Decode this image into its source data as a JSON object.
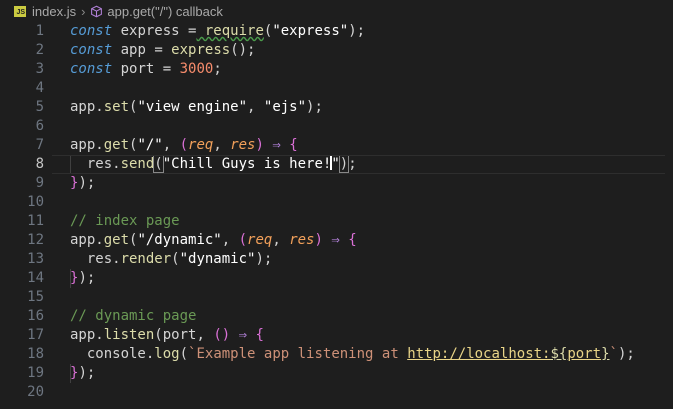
{
  "breadcrumb": {
    "file_icon_text": "JS",
    "file": "index.js",
    "symbol": "app.get(\"/\") callback"
  },
  "line_numbers": [
    "1",
    "2",
    "3",
    "4",
    "5",
    "6",
    "7",
    "8",
    "9",
    "10",
    "11",
    "12",
    "13",
    "14",
    "15",
    "16",
    "17",
    "18",
    "19",
    "20"
  ],
  "code": {
    "l1": {
      "kw": "const",
      "a": " express ",
      "op": "=",
      "fn": " require",
      "b": "(",
      "str": "\"express\"",
      "c": ");"
    },
    "l2": {
      "kw": "const",
      "a": " app ",
      "op": "=",
      "fn": " express",
      "b": "();"
    },
    "l3": {
      "kw": "const",
      "a": " port ",
      "op": "=",
      "num": " 3000",
      "b": ";"
    },
    "l5": {
      "a": "app.",
      "fn": "set",
      "b": "(",
      "s1": "\"view engine\"",
      "c": ", ",
      "s2": "\"ejs\"",
      "d": ");"
    },
    "l7": {
      "a": "app.",
      "fn": "get",
      "b": "(",
      "s1": "\"/\"",
      "c": ", ",
      "p_open": "(",
      "p1": "req",
      "comma": ", ",
      "p2": "res",
      "p_close": ")",
      "arrow": " ⇒ ",
      "brace": "{"
    },
    "l8": {
      "indent": "  ",
      "a": "res.",
      "fn": "send",
      "b": "(",
      "s1": "\"Chill Guys is here!",
      "s2": "\"",
      "c": ")",
      "d": ";"
    },
    "l9": {
      "brace": "}",
      "a": ");"
    },
    "l11": {
      "cmt": "// index page"
    },
    "l12": {
      "a": "app.",
      "fn": "get",
      "b": "(",
      "s1": "\"/dynamic\"",
      "c": ", ",
      "p_open": "(",
      "p1": "req",
      "comma": ", ",
      "p2": "res",
      "p_close": ")",
      "arrow": " ⇒ ",
      "brace": "{"
    },
    "l13": {
      "indent": "  ",
      "a": "res.",
      "fn": "render",
      "b": "(",
      "s1": "\"dynamic\"",
      "c": ");"
    },
    "l14": {
      "brace": "}",
      "a": ");"
    },
    "l16": {
      "cmt": "// dynamic page"
    },
    "l17": {
      "a": "app.",
      "fn": "listen",
      "b": "(port, ",
      "p_open": "(",
      "p_close": ")",
      "arrow": " ⇒ ",
      "brace": "{"
    },
    "l18": {
      "indent": "  ",
      "a": "console.",
      "fn": "log",
      "b": "(",
      "t1": "`Example app listening at ",
      "url": "http://localhost:",
      "interp_open": "${",
      "var": "port",
      "interp_close": "}",
      "t2": "`",
      "c": ");"
    },
    "l19": {
      "brace": "}",
      "a": ");"
    }
  },
  "colors": {
    "background": "#1e1e1e",
    "keyword": "#569cd6",
    "function": "#dcdcaa",
    "number": "#f78c6c",
    "comment": "#6a9955",
    "parameter": "#f2a05a",
    "arrow": "#b180d7"
  }
}
